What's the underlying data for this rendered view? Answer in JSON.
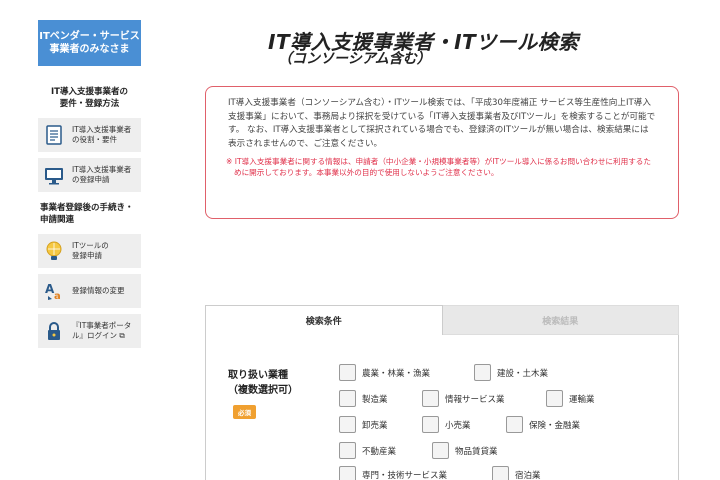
{
  "sidebar": {
    "vendor_button": "ITベンダー・サービス\n事業者のみなさま",
    "section1_title": "IT導入支援事業者の\n要件・登録方法",
    "section1_items": [
      {
        "label": "IT導入支援事業者\nの役割・要件",
        "icon": "document-icon"
      },
      {
        "label": "IT導入支援事業者\nの登録申請",
        "icon": "monitor-icon"
      }
    ],
    "section2_title": "事業者登録後の手続き・\n申請関連",
    "section2_items": [
      {
        "label": "ITツールの\n登録申請",
        "icon": "lightbulb-icon"
      },
      {
        "label": "登録情報の変更",
        "icon": "text-edit-icon"
      },
      {
        "label": "『IT事業者ポータ\nル』ログイン ⧉",
        "icon": "lock-icon"
      }
    ]
  },
  "header": {
    "title": "IT導入支援事業者・ITツール検索",
    "subtitle": "（コンソーシアム含む）"
  },
  "notice": {
    "main": "IT導入支援事業者（コンソーシアム含む）・ITツール検索では、「平成30年度補正 サービス等生産性向上IT導入支援事業」において、事務局より採択を受けている「IT導入支援事業者及びITツール」を検索することが可能です。 なお、IT導入支援事業者として採択されている場合でも、登録済のITツールが無い場合は、検索結果には表示されませんので、ご注意ください。",
    "warning": "※ IT導入支援事業者に関する情報は、申請者（中小企業・小規模事業者等）がITツール導入に係るお問い合わせに利用するために開示しております。本事業以外の目的で使用しないようご注意ください。"
  },
  "tabs": {
    "search_conditions": "検索条件",
    "search_results": "検索結果"
  },
  "industry": {
    "label": "取り扱い業種\n（複数選択可）",
    "required": "必須",
    "options": [
      "農業・林業・漁業",
      "建設・土木業",
      "製造業",
      "情報サービス業",
      "運輸業",
      "卸売業",
      "小売業",
      "保険・金融業",
      "不動産業",
      "物品賃貸業",
      "専門・技術サービス業",
      "宿泊業"
    ]
  },
  "colors": {
    "vendor_button": "#4a8fd4",
    "notice_border": "#e0606a",
    "warning_text": "#e0304a",
    "required_badge": "#f0a030"
  }
}
